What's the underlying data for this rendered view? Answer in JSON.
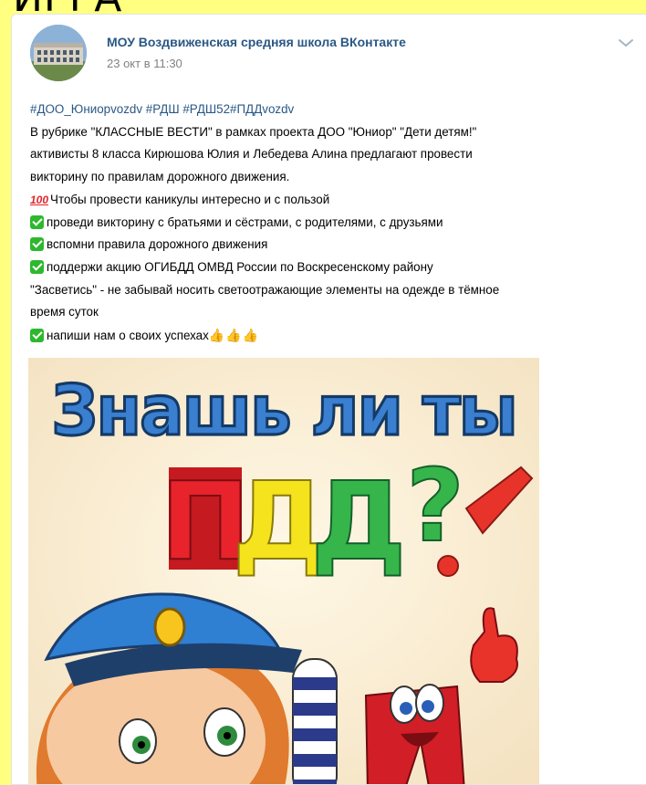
{
  "page": {
    "top_cut_text": "ИГРА"
  },
  "post": {
    "author": "МОУ Воздвиженская средняя школа ВКонтакте",
    "time": "23 окт в 11:30",
    "hashtags": "#ДОО_Юниорvozdv #РДШ #РДШ52#ПДДvozdv",
    "lines": [
      "В рубрике \"КЛАССНЫЕ ВЕСТИ\" в рамках проекта ДОО \"Юниор\" \"Дети детям!\"",
      "активисты 8 класса Кирюшова Юлия и Лебедева Алина предлагают провести",
      "викторину по правилам дорожного движения.",
      "Чтобы провести каникулы интересно и с пользой",
      "проведи викторину с братьями и сёстрами, с родителями, с друзьями",
      "вспомни правила дорожного движения",
      "поддержи акцию ОГИБДД ОМВД России по Воскресенскому району",
      "\"Засветись\" - не забывай носить светоотражающие элементы на одежде в тёмное",
      "время суток",
      "напиши нам о своих успехах"
    ],
    "hundred_glyph": "100",
    "thumbs": "👍👍👍"
  },
  "poster": {
    "line1": "Знашь ли ты",
    "letters": [
      "П",
      "Д",
      "Д"
    ],
    "question": "?",
    "letter_colors": [
      "#e8232b",
      "#f4e31d",
      "#36b54a"
    ],
    "title_color": "#3a7fd0"
  }
}
